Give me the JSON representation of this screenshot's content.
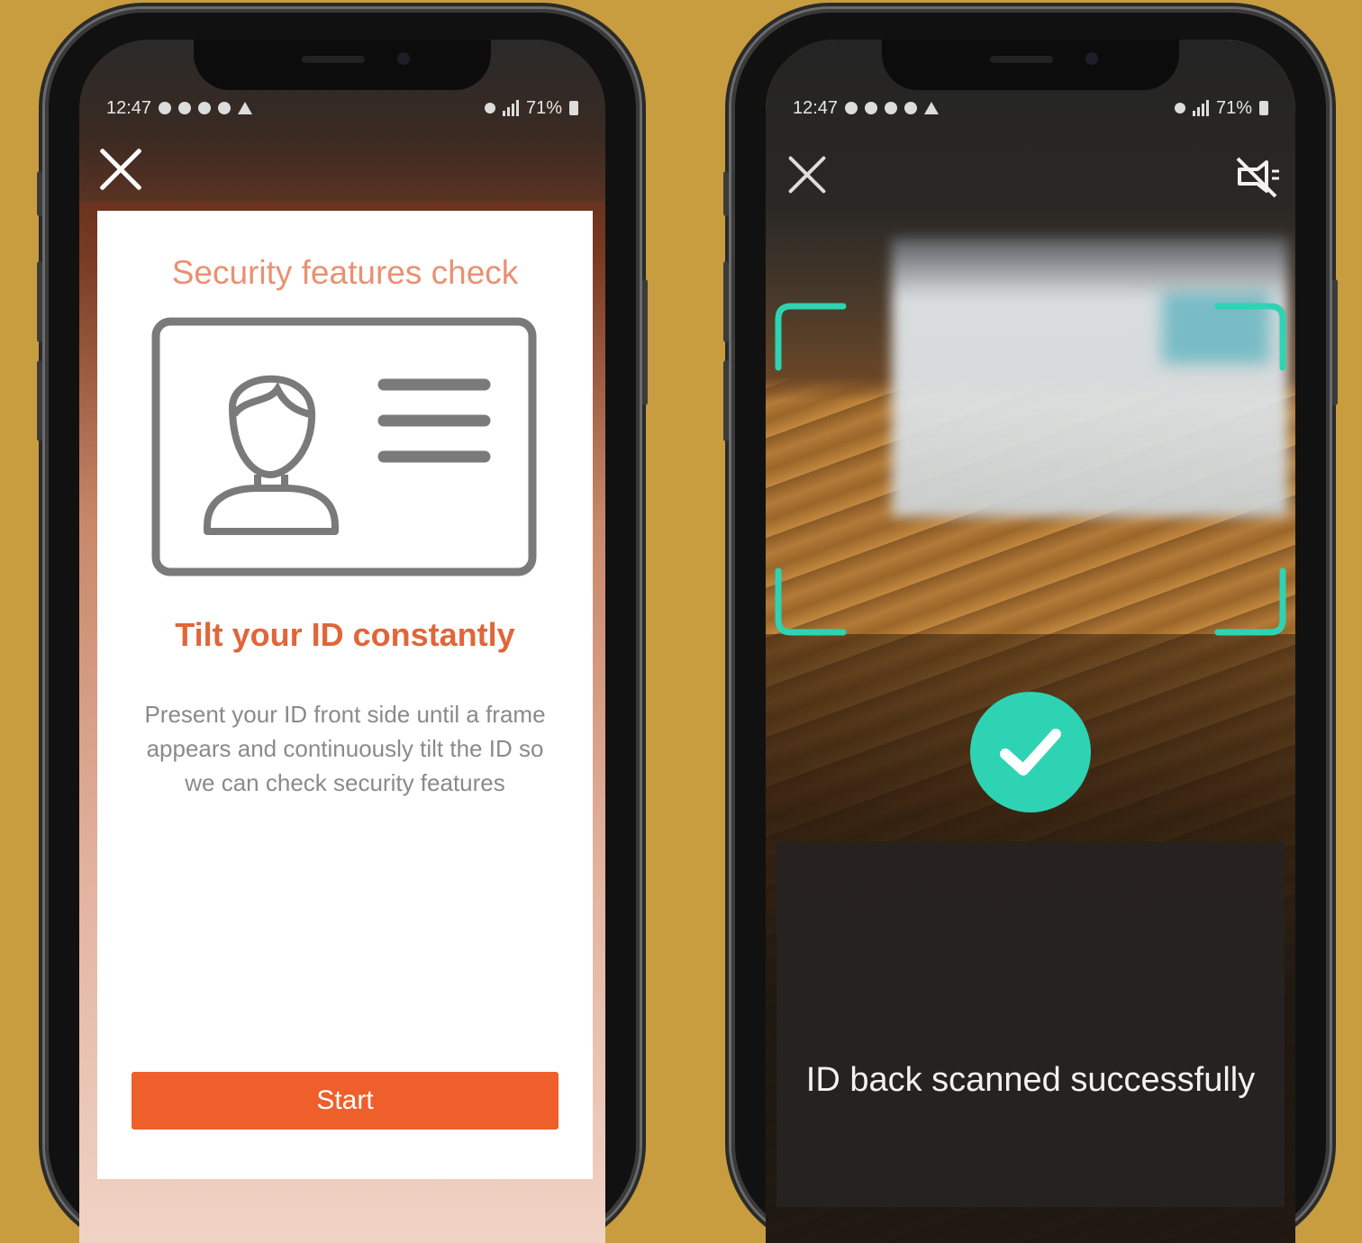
{
  "colors": {
    "background": "#c89d3f",
    "accent_orange": "#ee5f2b",
    "title_orange": "#e99172",
    "success_teal": "#2ed3b3"
  },
  "left_phone": {
    "status": {
      "time": "12:47",
      "battery": "71%"
    },
    "close_icon": "close-icon",
    "card": {
      "title": "Security features check",
      "illustration_icon": "id-card-icon",
      "heading": "Tilt your ID constantly",
      "description": "Present your ID front side until a frame appears and continuously tilt the ID so we can check security features",
      "start_label": "Start"
    }
  },
  "right_phone": {
    "status": {
      "time": "12:47",
      "battery": "71%"
    },
    "close_icon": "close-icon",
    "flash_icon": "flash-off-icon",
    "check_icon": "checkmark-icon",
    "result_text": "ID back scanned successfully"
  }
}
